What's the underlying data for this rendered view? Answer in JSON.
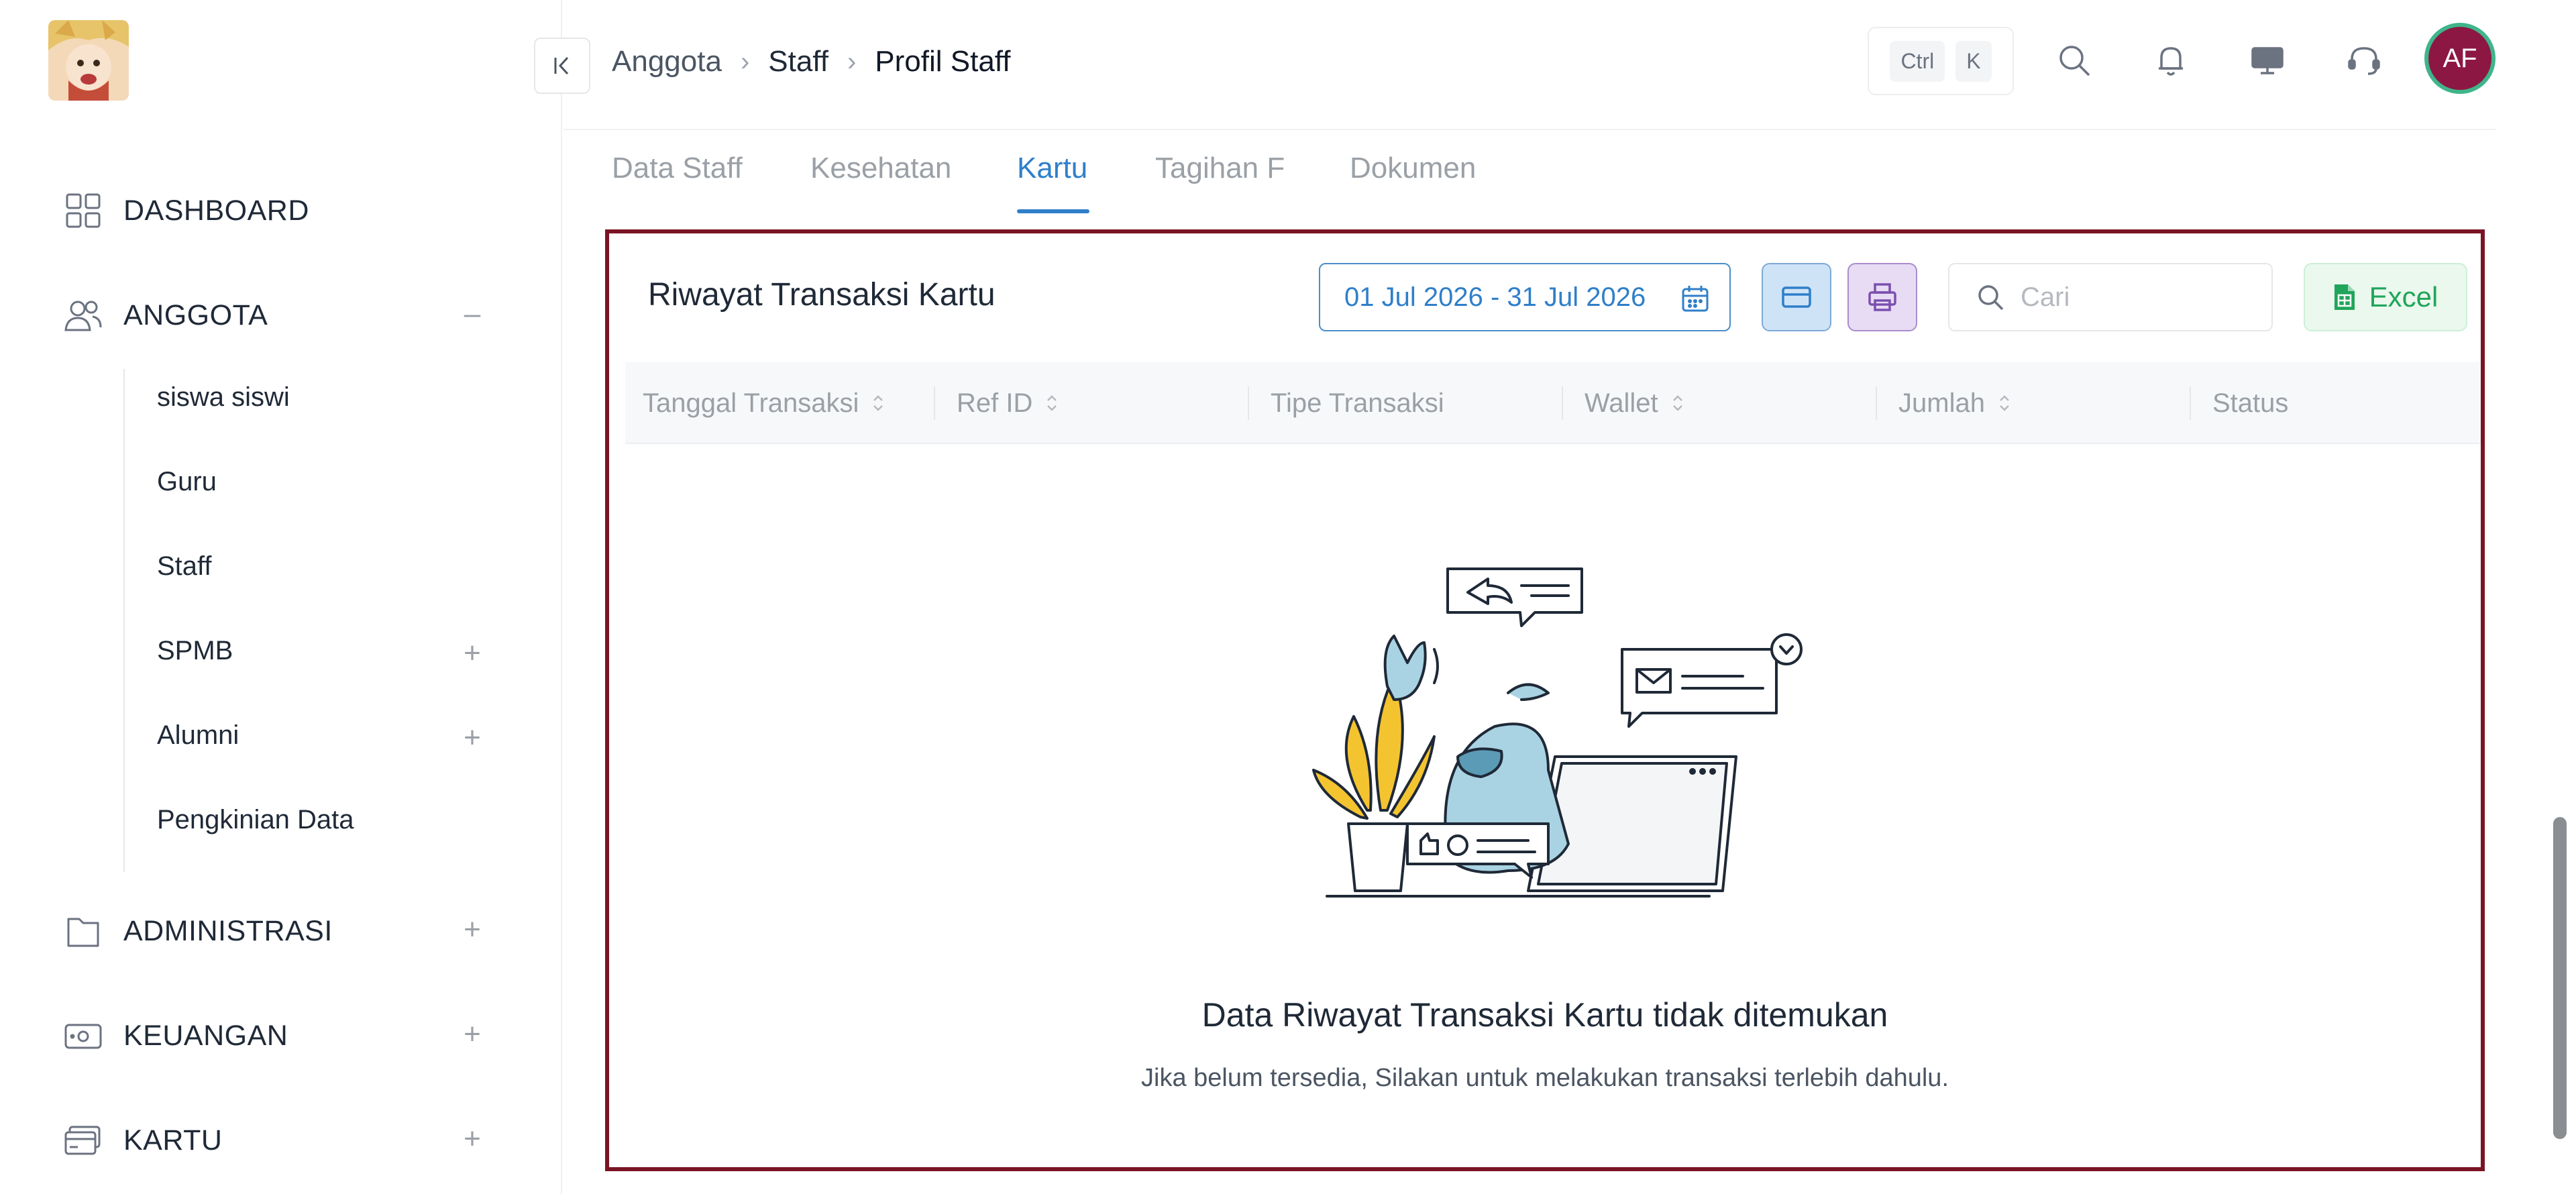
{
  "sidebar": {
    "dashboard": "DASHBOARD",
    "anggota": "ANGGOTA",
    "anggota_items": [
      {
        "label": "siswa siswi"
      },
      {
        "label": "Guru"
      },
      {
        "label": "Staff"
      },
      {
        "label": "SPMB"
      },
      {
        "label": "Alumni"
      },
      {
        "label": "Pengkinian Data"
      }
    ],
    "administrasi": "ADMINISTRASI",
    "keuangan": "KEUANGAN",
    "kartu": "KARTU"
  },
  "header": {
    "breadcrumb": [
      "Anggota",
      "Staff",
      "Profil Staff"
    ],
    "shortcut": [
      "Ctrl",
      "K"
    ],
    "avatar_initials": "AF"
  },
  "tabs": [
    {
      "label": "Data Staff"
    },
    {
      "label": "Kesehatan"
    },
    {
      "label": "Kartu"
    },
    {
      "label": "Tagihan F"
    },
    {
      "label": "Dokumen"
    }
  ],
  "card": {
    "title": "Riwayat Transaksi Kartu",
    "date_range": "01 Jul 2026 - 31 Jul 2026",
    "search_placeholder": "Cari",
    "excel_label": "Excel",
    "columns": [
      {
        "label": "Tanggal Transaksi",
        "sortable": true
      },
      {
        "label": "Ref ID",
        "sortable": true
      },
      {
        "label": "Tipe Transaksi",
        "sortable": false
      },
      {
        "label": "Wallet",
        "sortable": true
      },
      {
        "label": "Jumlah",
        "sortable": true
      },
      {
        "label": "Status",
        "sortable": false
      }
    ],
    "empty_title": "Data Riwayat Transaksi Kartu tidak ditemukan",
    "empty_subtitle": "Jika belum tersedia, Silakan untuk melakukan transaksi terlebih dahulu."
  },
  "colors": {
    "accent": "#2f7fc9",
    "highlight_border": "#7a1424",
    "avatar_bg": "#8c1742",
    "avatar_ring": "#3fb58a",
    "excel_green": "#21a55a"
  }
}
